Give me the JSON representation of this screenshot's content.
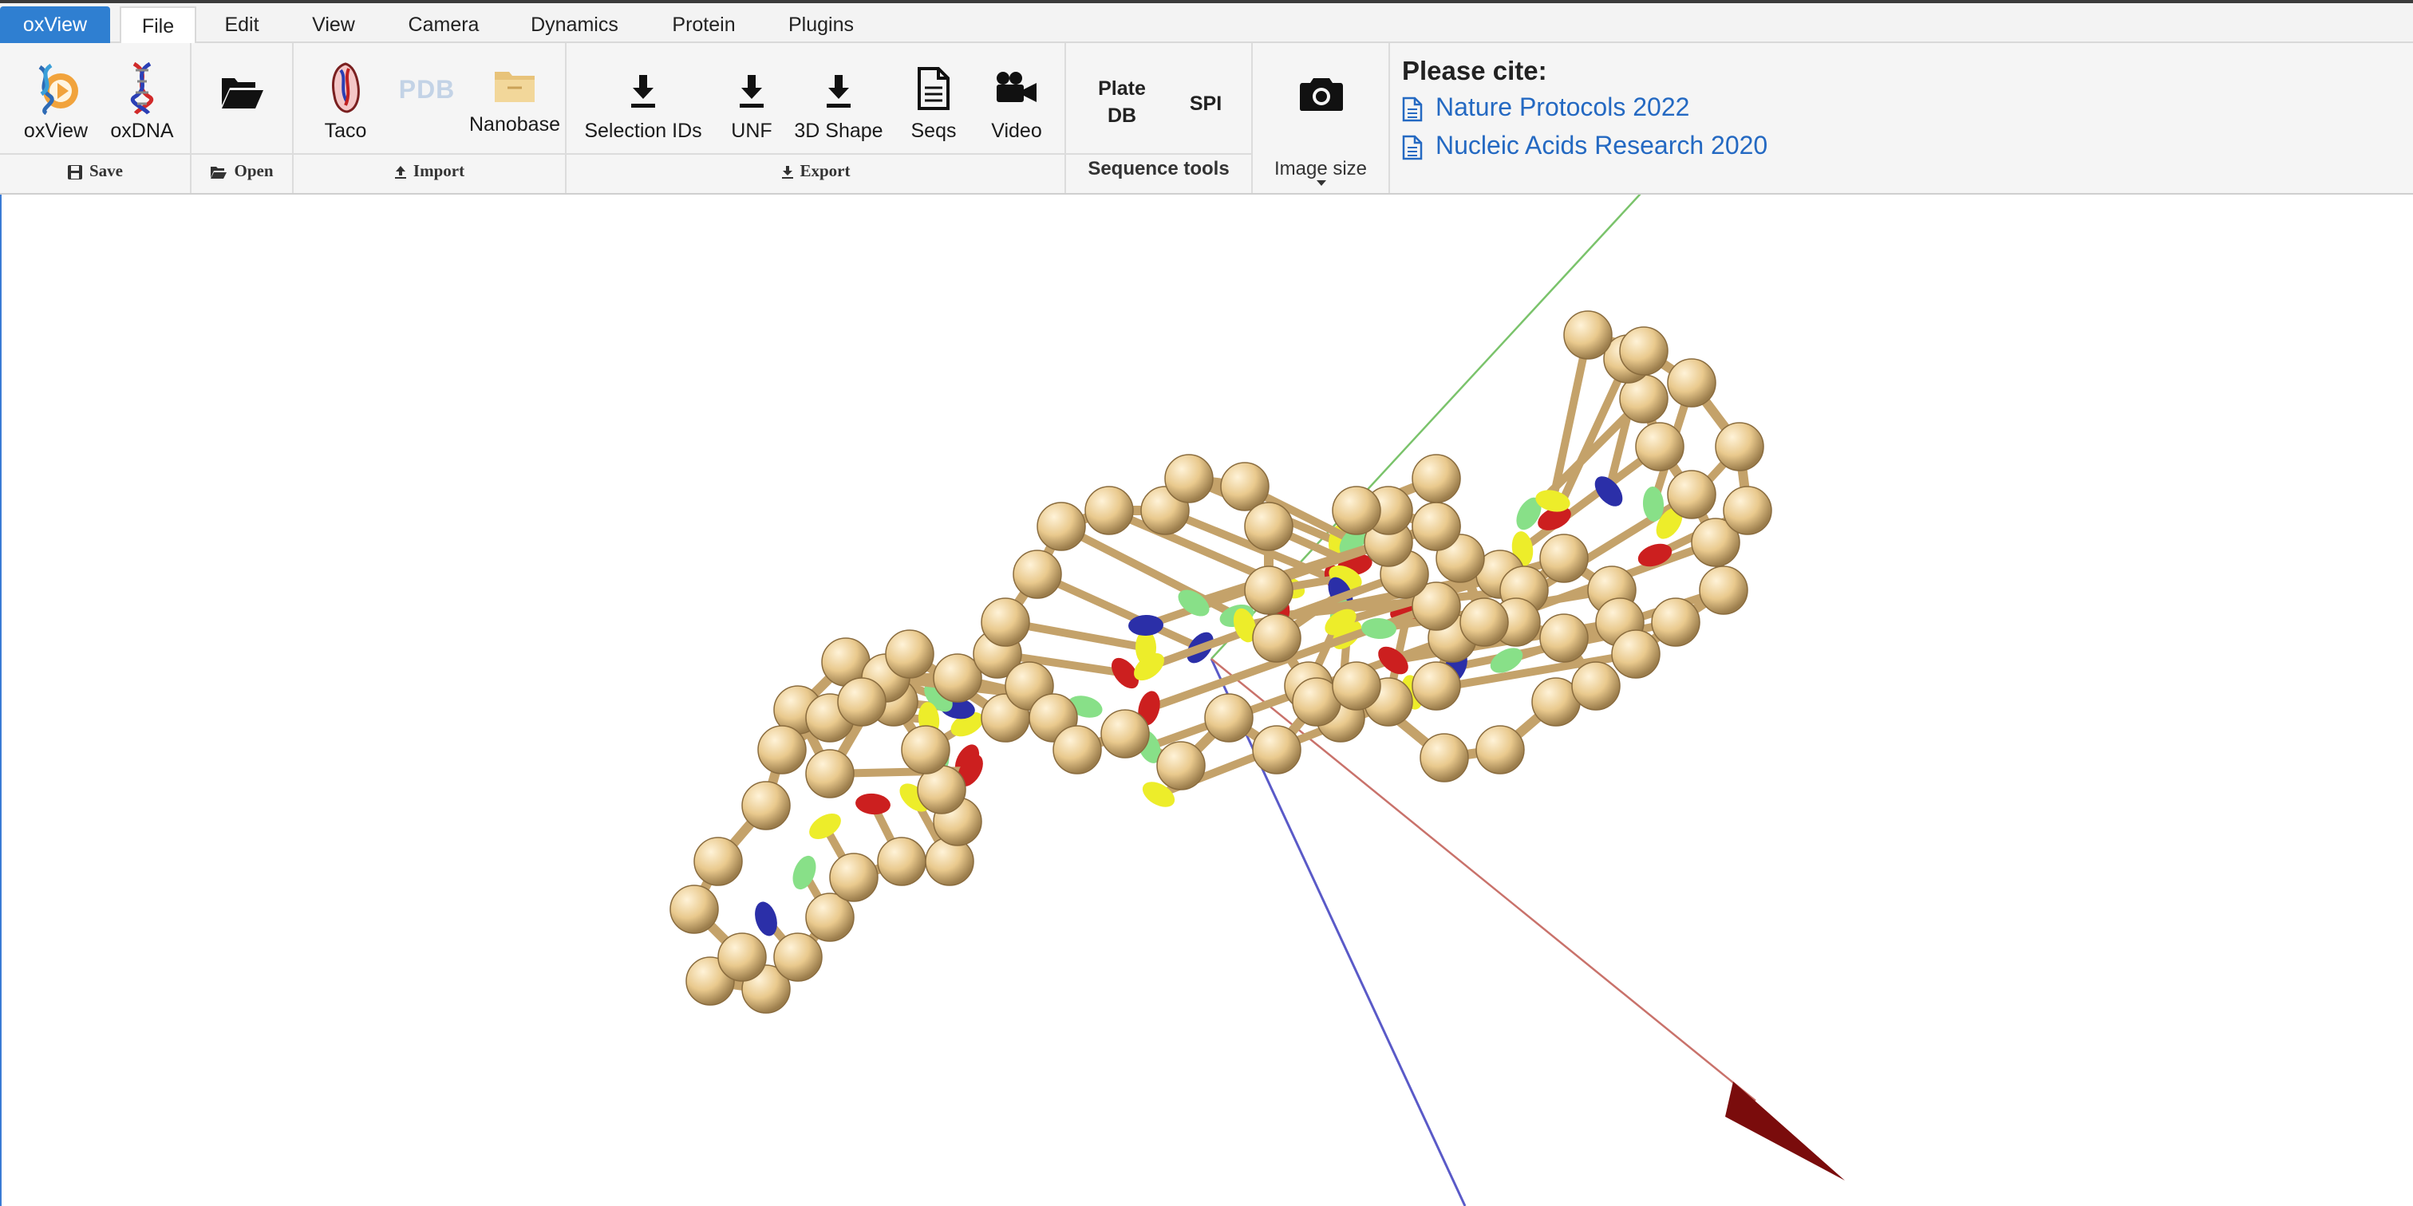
{
  "menu": {
    "brand": "oxView",
    "tabs": [
      "File",
      "Edit",
      "View",
      "Camera",
      "Dynamics",
      "Protein",
      "Plugins"
    ],
    "active_tab": "File"
  },
  "ribbon": {
    "save": {
      "label": "Save",
      "buttons": [
        "oxView",
        "oxDNA"
      ]
    },
    "open": {
      "label": "Open"
    },
    "import": {
      "label": "Import",
      "buttons": [
        "Taco",
        "PDB",
        "Nanobase"
      ]
    },
    "export": {
      "label": "Export",
      "buttons": [
        "Selection IDs",
        "UNF",
        "3D Shape",
        "Seqs",
        "Video"
      ]
    },
    "sequence_tools": {
      "label": "Sequence tools",
      "plate_line1": "Plate",
      "plate_line2": "DB",
      "spi": "SPI"
    },
    "image": {
      "label": "Image size"
    }
  },
  "cite": {
    "title": "Please cite:",
    "links": [
      "Nature Protocols 2022",
      "Nucleic Acids Research 2020"
    ]
  },
  "scene": {
    "description_colors": {
      "backbone": "#e9c98d",
      "base_red": "#cc1f1f",
      "base_yellow": "#eded2a",
      "base_blue": "#2b2fa8",
      "base_green": "#88e088",
      "axis_x": "#c9726b",
      "axis_y": "#7ac36b",
      "axis_z": "#5a5ac8",
      "arrow": "#7a0c0c"
    }
  }
}
